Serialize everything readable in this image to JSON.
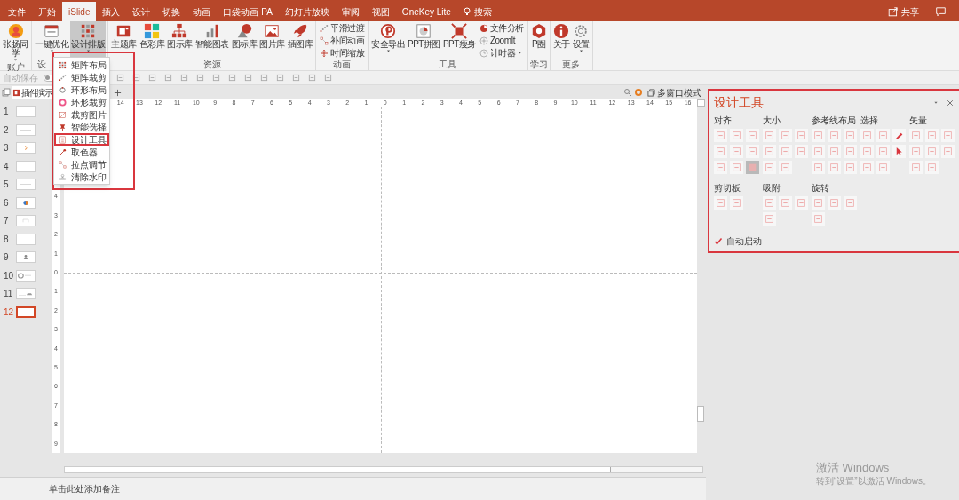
{
  "tabs": [
    {
      "label": "文件",
      "selected": false
    },
    {
      "label": "开始",
      "selected": false
    },
    {
      "label": "iSlide",
      "selected": true
    },
    {
      "label": "插入",
      "selected": false
    },
    {
      "label": "设计",
      "selected": false
    },
    {
      "label": "切换",
      "selected": false
    },
    {
      "label": "动画",
      "selected": false
    },
    {
      "label": "口袋动画 PA",
      "selected": false
    },
    {
      "label": "幻灯片放映",
      "selected": false
    },
    {
      "label": "审阅",
      "selected": false
    },
    {
      "label": "视图",
      "selected": false
    },
    {
      "label": "OneKey Lite",
      "selected": false
    }
  ],
  "search": {
    "label": "搜索"
  },
  "share": {
    "label": "共享"
  },
  "ribbon": {
    "groups": [
      {
        "label": "账户",
        "buttons": [
          {
            "kind": "large",
            "label": "张扬同学",
            "dropdown": true,
            "pressed": false
          }
        ]
      },
      {
        "label": "设",
        "buttons": [
          {
            "kind": "large",
            "label": "一键优化",
            "dropdown": true,
            "pressed": false
          },
          {
            "kind": "large",
            "label": "设计排版",
            "dropdown": true,
            "pressed": true
          }
        ]
      },
      {
        "label": "资源",
        "buttons": [
          {
            "kind": "large",
            "label": "主题库",
            "dropdown": false,
            "pressed": false
          },
          {
            "kind": "large",
            "label": "色彩库",
            "dropdown": false,
            "pressed": false
          },
          {
            "kind": "large",
            "label": "图示库",
            "dropdown": false,
            "pressed": false
          },
          {
            "kind": "large",
            "label": "智能图表",
            "dropdown": false,
            "pressed": false
          },
          {
            "kind": "large",
            "label": "图标库",
            "dropdown": false,
            "pressed": false
          },
          {
            "kind": "large",
            "label": "图片库",
            "dropdown": false,
            "pressed": false
          },
          {
            "kind": "large",
            "label": "插图库",
            "dropdown": false,
            "pressed": false
          }
        ]
      },
      {
        "label": "动画",
        "buttons": [
          {
            "kind": "small",
            "label": "平滑过渡",
            "dropdown": false,
            "pressed": false
          },
          {
            "kind": "small",
            "label": "补间动画",
            "dropdown": false,
            "pressed": false
          },
          {
            "kind": "small",
            "label": "时间缩放",
            "dropdown": false,
            "pressed": false
          }
        ]
      },
      {
        "label": "工具",
        "buttons": [
          {
            "kind": "large",
            "label": "安全导出",
            "dropdown": true,
            "pressed": false
          },
          {
            "kind": "large",
            "label": "PPT拼图",
            "dropdown": false,
            "pressed": false
          },
          {
            "kind": "large",
            "label": "PPT瘦身",
            "dropdown": false,
            "pressed": false
          },
          {
            "kind": "small",
            "label": "文件分析",
            "dropdown": false,
            "pressed": false
          },
          {
            "kind": "small",
            "label": "ZoomIt",
            "dropdown": false,
            "pressed": false
          },
          {
            "kind": "small",
            "label": "计时器",
            "dropdown": true,
            "pressed": false
          }
        ]
      },
      {
        "label": "学习",
        "buttons": [
          {
            "kind": "large",
            "label": "P圈",
            "dropdown": false,
            "pressed": false
          }
        ]
      },
      {
        "label": "更多",
        "buttons": [
          {
            "kind": "large",
            "label": "关于",
            "dropdown": false,
            "pressed": false
          },
          {
            "kind": "large",
            "label": "设置",
            "dropdown": true,
            "pressed": false
          }
        ]
      }
    ]
  },
  "quick_access": {
    "label": "自动保存",
    "autosave_on": false
  },
  "document_tab": {
    "label": "插件演示"
  },
  "window_mode": {
    "label": "多窗口模式"
  },
  "menu": {
    "items": [
      {
        "label": "矩阵布局",
        "kind": "grid",
        "selected": false
      },
      {
        "label": "矩阵裁剪",
        "kind": "dots",
        "selected": false
      },
      {
        "label": "环形布局",
        "kind": "ring",
        "selected": false
      },
      {
        "label": "环形裁剪",
        "kind": "donut",
        "selected": false
      },
      {
        "label": "裁剪图片",
        "kind": "crop",
        "selected": false
      },
      {
        "label": "智能选择",
        "kind": "pin",
        "selected": false
      },
      {
        "label": "设计工具",
        "kind": "tool",
        "selected": true
      },
      {
        "label": "取色器",
        "kind": "dropper",
        "selected": false
      },
      {
        "label": "拉点调节",
        "kind": "nodes",
        "selected": false
      },
      {
        "label": "清除水印",
        "kind": "stamp",
        "selected": false
      }
    ]
  },
  "slides": [
    {
      "number": "1",
      "kind": "blank",
      "selected": false
    },
    {
      "number": "2",
      "kind": "text",
      "selected": false
    },
    {
      "number": "3",
      "kind": "ring",
      "selected": false
    },
    {
      "number": "4",
      "kind": "blank",
      "selected": false
    },
    {
      "number": "5",
      "kind": "text",
      "selected": false
    },
    {
      "number": "6",
      "kind": "pie",
      "selected": false
    },
    {
      "number": "7",
      "kind": "outline",
      "selected": false
    },
    {
      "number": "8",
      "kind": "blank",
      "selected": false
    },
    {
      "number": "9",
      "kind": "figure",
      "selected": false
    },
    {
      "number": "10",
      "kind": "toggle",
      "selected": false
    },
    {
      "number": "11",
      "kind": "car",
      "selected": false
    },
    {
      "number": "12",
      "kind": "blank",
      "selected": true
    }
  ],
  "ruler_horizontal": [
    "14",
    "13",
    "12",
    "11",
    "10",
    "9",
    "8",
    "7",
    "6",
    "5",
    "4",
    "3",
    "2",
    "1",
    "0",
    "1",
    "2",
    "3",
    "4",
    "5",
    "6",
    "7",
    "8",
    "9",
    "10",
    "11",
    "12",
    "13",
    "14",
    "15",
    "16"
  ],
  "ruler_vertical": [
    "4",
    "3",
    "2",
    "1",
    "0",
    "1",
    "2",
    "3",
    "4",
    "5",
    "6",
    "7",
    "8",
    "9"
  ],
  "panel": {
    "title": "设计工具",
    "rows": [
      [
        {
          "label": "对齐",
          "tools": [
            {
              "kind": "plain"
            },
            {
              "kind": "plain"
            },
            {
              "kind": "plain"
            },
            {
              "kind": "plain"
            },
            {
              "kind": "plain"
            },
            {
              "kind": "plain"
            },
            {
              "kind": "plain"
            },
            {
              "kind": "plain"
            },
            {
              "kind": "pressed"
            }
          ]
        },
        {
          "label": "大小",
          "tools": [
            {
              "kind": "plain"
            },
            {
              "kind": "plain"
            },
            {
              "kind": "plain"
            },
            {
              "kind": "plain"
            },
            {
              "kind": "plain"
            },
            {
              "kind": "plain"
            },
            {
              "kind": "plain"
            },
            {
              "kind": "plain"
            }
          ]
        },
        {
          "label": "参考线布局",
          "tools": [
            {
              "kind": "plain"
            },
            {
              "kind": "plain"
            },
            {
              "kind": "plain"
            },
            {
              "kind": "plain"
            },
            {
              "kind": "plain"
            },
            {
              "kind": "plain"
            },
            {
              "kind": "plain"
            },
            {
              "kind": "plain"
            },
            {
              "kind": "plain"
            }
          ]
        },
        {
          "label": "选择",
          "tools": [
            {
              "kind": "plain"
            },
            {
              "kind": "plain"
            },
            {
              "kind": "pen"
            },
            {
              "kind": "plain"
            },
            {
              "kind": "plain"
            },
            {
              "kind": "cursor"
            },
            {
              "kind": "plain"
            },
            {
              "kind": "plain"
            }
          ]
        },
        {
          "label": "矢量",
          "tools": [
            {
              "kind": "plain"
            },
            {
              "kind": "plain"
            },
            {
              "kind": "plain"
            },
            {
              "kind": "plain"
            },
            {
              "kind": "plain"
            },
            {
              "kind": "plain"
            },
            {
              "kind": "plain"
            },
            {
              "kind": "plain"
            }
          ]
        }
      ],
      [
        {
          "label": "剪切板",
          "tools": [
            {
              "kind": "plain"
            },
            {
              "kind": "plain"
            }
          ]
        },
        {
          "label": "吸附",
          "tools": [
            {
              "kind": "plain"
            },
            {
              "kind": "plain"
            },
            {
              "kind": "plain"
            },
            {
              "kind": "plain"
            }
          ]
        },
        {
          "label": "旋转",
          "tools": [
            {
              "kind": "plain"
            },
            {
              "kind": "plain"
            },
            {
              "kind": "plain"
            },
            {
              "kind": "plain"
            }
          ]
        }
      ]
    ],
    "auto_start": {
      "label": "自动启动",
      "checked": true
    }
  },
  "notes": {
    "placeholder": "单击此处添加备注"
  },
  "activation": {
    "title": "激活 Windows",
    "hint": "转到“设置”以激活 Windows。"
  }
}
